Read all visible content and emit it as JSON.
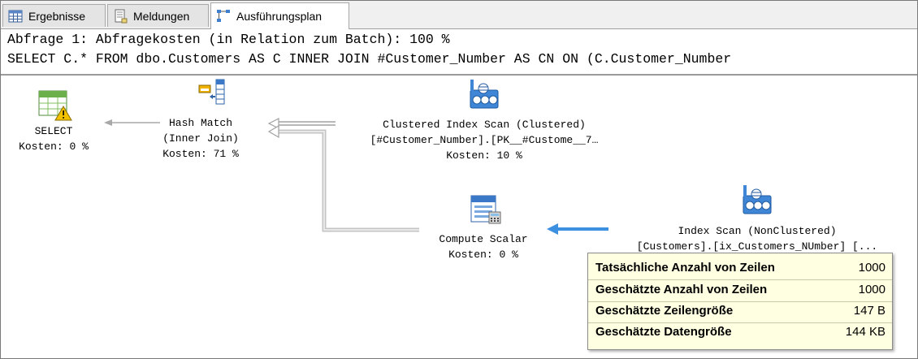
{
  "tabs": [
    {
      "label": "Ergebnisse",
      "icon": "results-grid-icon",
      "active": false
    },
    {
      "label": "Meldungen",
      "icon": "messages-icon",
      "active": false
    },
    {
      "label": "Ausführungsplan",
      "icon": "execution-plan-icon",
      "active": true
    }
  ],
  "query": {
    "line1": "Abfrage 1: Abfragekosten (in Relation zum Batch): 100 %",
    "line2": "SELECT C.* FROM dbo.Customers AS C INNER JOIN #Customer_Number AS CN ON (C.Customer_Number"
  },
  "plan": {
    "nodes": {
      "select": {
        "title": "SELECT",
        "cost": "Kosten: 0 %",
        "icon": "select-warning-icon"
      },
      "hash_match": {
        "title": "Hash Match",
        "subtitle": "(Inner Join)",
        "cost": "Kosten: 71 %",
        "icon": "hash-match-icon"
      },
      "clustered_scan": {
        "title": "Clustered Index Scan (Clustered)",
        "subtitle": "[#Customer_Number].[PK__#Custome__7…",
        "cost": "Kosten: 10 %",
        "icon": "clustered-index-scan-icon"
      },
      "compute_scalar": {
        "title": "Compute Scalar",
        "cost": "Kosten: 0 %",
        "icon": "compute-scalar-icon"
      },
      "index_scan": {
        "title": "Index Scan (NonClustered)",
        "subtitle": "[Customers].[ix_Customers_NUmber] [...",
        "icon": "index-scan-icon"
      }
    }
  },
  "tooltip": {
    "rows": [
      {
        "label": "Tatsächliche Anzahl von Zeilen",
        "value": "1000"
      },
      {
        "label": "Geschätzte Anzahl von Zeilen",
        "value": "1000"
      },
      {
        "label": "Geschätzte Zeilengröße",
        "value": "147 B"
      },
      {
        "label": "Geschätzte Datengröße",
        "value": "144 KB"
      }
    ]
  },
  "colors": {
    "tooltip_bg": "#ffffe1",
    "highlight_arrow": "#3d8fe0",
    "arrow_gray": "#b0b0b0"
  }
}
